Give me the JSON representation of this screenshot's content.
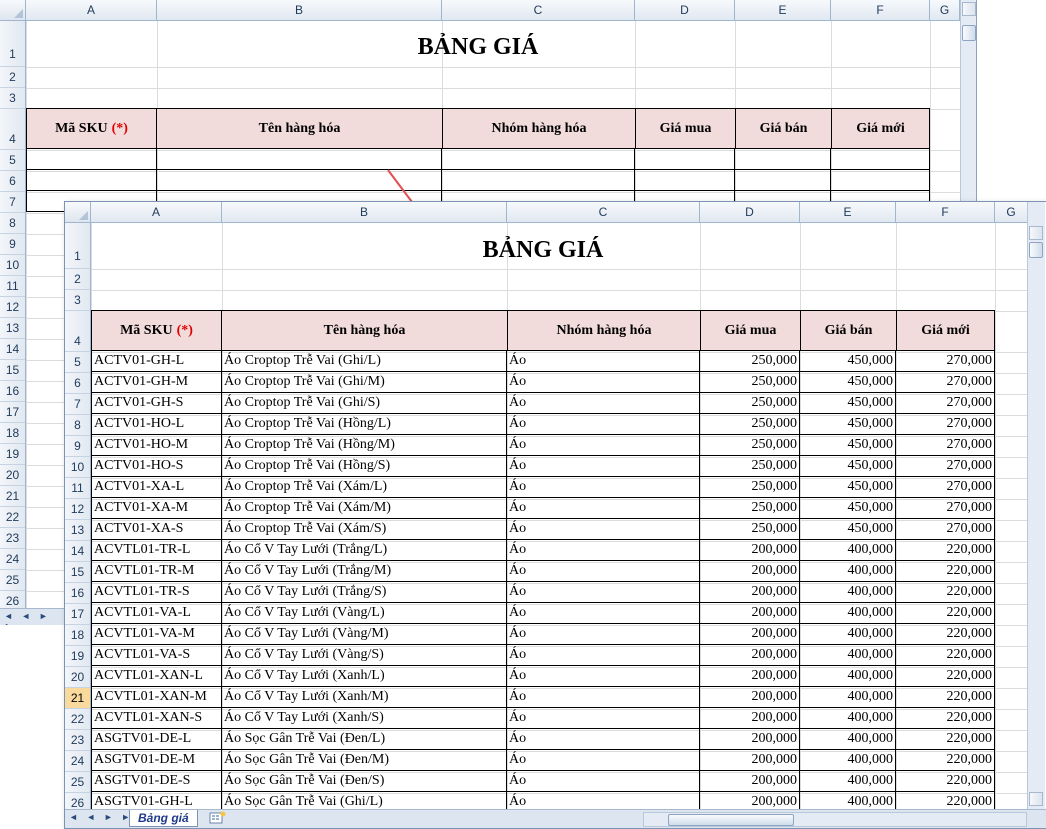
{
  "back_sheet": {
    "column_headers": [
      "A",
      "B",
      "C",
      "D",
      "E",
      "F",
      "G"
    ],
    "row_numbers": [
      "1",
      "2",
      "3",
      "4",
      "5",
      "6",
      "7",
      "8",
      "9",
      "10",
      "11",
      "12",
      "13",
      "14",
      "15",
      "16",
      "17",
      "18",
      "19",
      "20",
      "21",
      "22",
      "23",
      "24",
      "25",
      "26"
    ],
    "title": "BẢNG GIÁ",
    "table_headers": {
      "sku": "Mã SKU",
      "required_mark": "(*)",
      "name": "Tên hàng hóa",
      "group": "Nhóm hàng hóa",
      "buy": "Giá mua",
      "sell": "Giá bán",
      "new": "Giá mới"
    }
  },
  "front_sheet": {
    "column_headers": [
      "A",
      "B",
      "C",
      "D",
      "E",
      "F",
      "G"
    ],
    "title": "BẢNG GIÁ",
    "table_headers": {
      "sku": "Mã SKU",
      "required_mark": "(*)",
      "name": "Tên hàng hóa",
      "group": "Nhóm hàng hóa",
      "buy": "Giá mua",
      "sell": "Giá bán",
      "new": "Giá mới"
    },
    "selected_row": "21",
    "rows": [
      {
        "n": "5",
        "sku": "ACTV01-GH-L",
        "name": "Áo Croptop Trễ Vai (Ghi/L)",
        "group": "Áo",
        "buy": "250,000",
        "sell": "450,000",
        "new": "270,000"
      },
      {
        "n": "6",
        "sku": "ACTV01-GH-M",
        "name": "Áo Croptop Trễ Vai (Ghi/M)",
        "group": "Áo",
        "buy": "250,000",
        "sell": "450,000",
        "new": "270,000"
      },
      {
        "n": "7",
        "sku": "ACTV01-GH-S",
        "name": "Áo Croptop Trễ Vai (Ghi/S)",
        "group": "Áo",
        "buy": "250,000",
        "sell": "450,000",
        "new": "270,000"
      },
      {
        "n": "8",
        "sku": "ACTV01-HO-L",
        "name": "Áo Croptop Trễ Vai (Hồng/L)",
        "group": "Áo",
        "buy": "250,000",
        "sell": "450,000",
        "new": "270,000"
      },
      {
        "n": "9",
        "sku": "ACTV01-HO-M",
        "name": "Áo Croptop Trễ Vai (Hồng/M)",
        "group": "Áo",
        "buy": "250,000",
        "sell": "450,000",
        "new": "270,000"
      },
      {
        "n": "10",
        "sku": "ACTV01-HO-S",
        "name": "Áo Croptop Trễ Vai (Hồng/S)",
        "group": "Áo",
        "buy": "250,000",
        "sell": "450,000",
        "new": "270,000"
      },
      {
        "n": "11",
        "sku": "ACTV01-XA-L",
        "name": "Áo Croptop Trễ Vai (Xám/L)",
        "group": "Áo",
        "buy": "250,000",
        "sell": "450,000",
        "new": "270,000"
      },
      {
        "n": "12",
        "sku": "ACTV01-XA-M",
        "name": "Áo Croptop Trễ Vai (Xám/M)",
        "group": "Áo",
        "buy": "250,000",
        "sell": "450,000",
        "new": "270,000"
      },
      {
        "n": "13",
        "sku": "ACTV01-XA-S",
        "name": "Áo Croptop Trễ Vai (Xám/S)",
        "group": "Áo",
        "buy": "250,000",
        "sell": "450,000",
        "new": "270,000"
      },
      {
        "n": "14",
        "sku": "ACVTL01-TR-L",
        "name": "Áo Cổ V Tay Lưới (Trắng/L)",
        "group": "Áo",
        "buy": "200,000",
        "sell": "400,000",
        "new": "220,000"
      },
      {
        "n": "15",
        "sku": "ACVTL01-TR-M",
        "name": "Áo Cổ V Tay Lưới (Trắng/M)",
        "group": "Áo",
        "buy": "200,000",
        "sell": "400,000",
        "new": "220,000"
      },
      {
        "n": "16",
        "sku": "ACVTL01-TR-S",
        "name": "Áo Cổ V Tay Lưới (Trắng/S)",
        "group": "Áo",
        "buy": "200,000",
        "sell": "400,000",
        "new": "220,000"
      },
      {
        "n": "17",
        "sku": "ACVTL01-VA-L",
        "name": "Áo Cổ V Tay Lưới (Vàng/L)",
        "group": "Áo",
        "buy": "200,000",
        "sell": "400,000",
        "new": "220,000"
      },
      {
        "n": "18",
        "sku": "ACVTL01-VA-M",
        "name": "Áo Cổ V Tay Lưới (Vàng/M)",
        "group": "Áo",
        "buy": "200,000",
        "sell": "400,000",
        "new": "220,000"
      },
      {
        "n": "19",
        "sku": "ACVTL01-VA-S",
        "name": "Áo Cổ V Tay Lưới (Vàng/S)",
        "group": "Áo",
        "buy": "200,000",
        "sell": "400,000",
        "new": "220,000"
      },
      {
        "n": "20",
        "sku": "ACVTL01-XAN-L",
        "name": "Áo Cổ V Tay Lưới (Xanh/L)",
        "group": "Áo",
        "buy": "200,000",
        "sell": "400,000",
        "new": "220,000"
      },
      {
        "n": "21",
        "sku": "ACVTL01-XAN-M",
        "name": "Áo Cổ V Tay Lưới (Xanh/M)",
        "group": "Áo",
        "buy": "200,000",
        "sell": "400,000",
        "new": "220,000"
      },
      {
        "n": "22",
        "sku": "ACVTL01-XAN-S",
        "name": "Áo Cổ V Tay Lưới (Xanh/S)",
        "group": "Áo",
        "buy": "200,000",
        "sell": "400,000",
        "new": "220,000"
      },
      {
        "n": "23",
        "sku": "ASGTV01-DE-L",
        "name": "Áo Sọc Gân Trễ Vai (Đen/L)",
        "group": "Áo",
        "buy": "200,000",
        "sell": "400,000",
        "new": "220,000"
      },
      {
        "n": "24",
        "sku": "ASGTV01-DE-M",
        "name": "Áo Sọc Gân Trễ Vai (Đen/M)",
        "group": "Áo",
        "buy": "200,000",
        "sell": "400,000",
        "new": "220,000"
      },
      {
        "n": "25",
        "sku": "ASGTV01-DE-S",
        "name": "Áo Sọc Gân Trễ Vai (Đen/S)",
        "group": "Áo",
        "buy": "200,000",
        "sell": "400,000",
        "new": "220,000"
      },
      {
        "n": "26",
        "sku": "ASGTV01-GH-L",
        "name": "Áo Sọc Gân Trễ Vai (Ghi/L)",
        "group": "Áo",
        "buy": "200,000",
        "sell": "400,000",
        "new": "220,000"
      }
    ],
    "sheet_tab": "Bảng giá",
    "icons": {
      "nav": "sheet-nav-arrows-icon",
      "new_sheet": "insert-sheet-icon"
    }
  },
  "colors": {
    "header_fill": "#f2dcdb",
    "required": "#e00000",
    "arrow": "#e05050",
    "selected_row": "#f9d99c"
  }
}
